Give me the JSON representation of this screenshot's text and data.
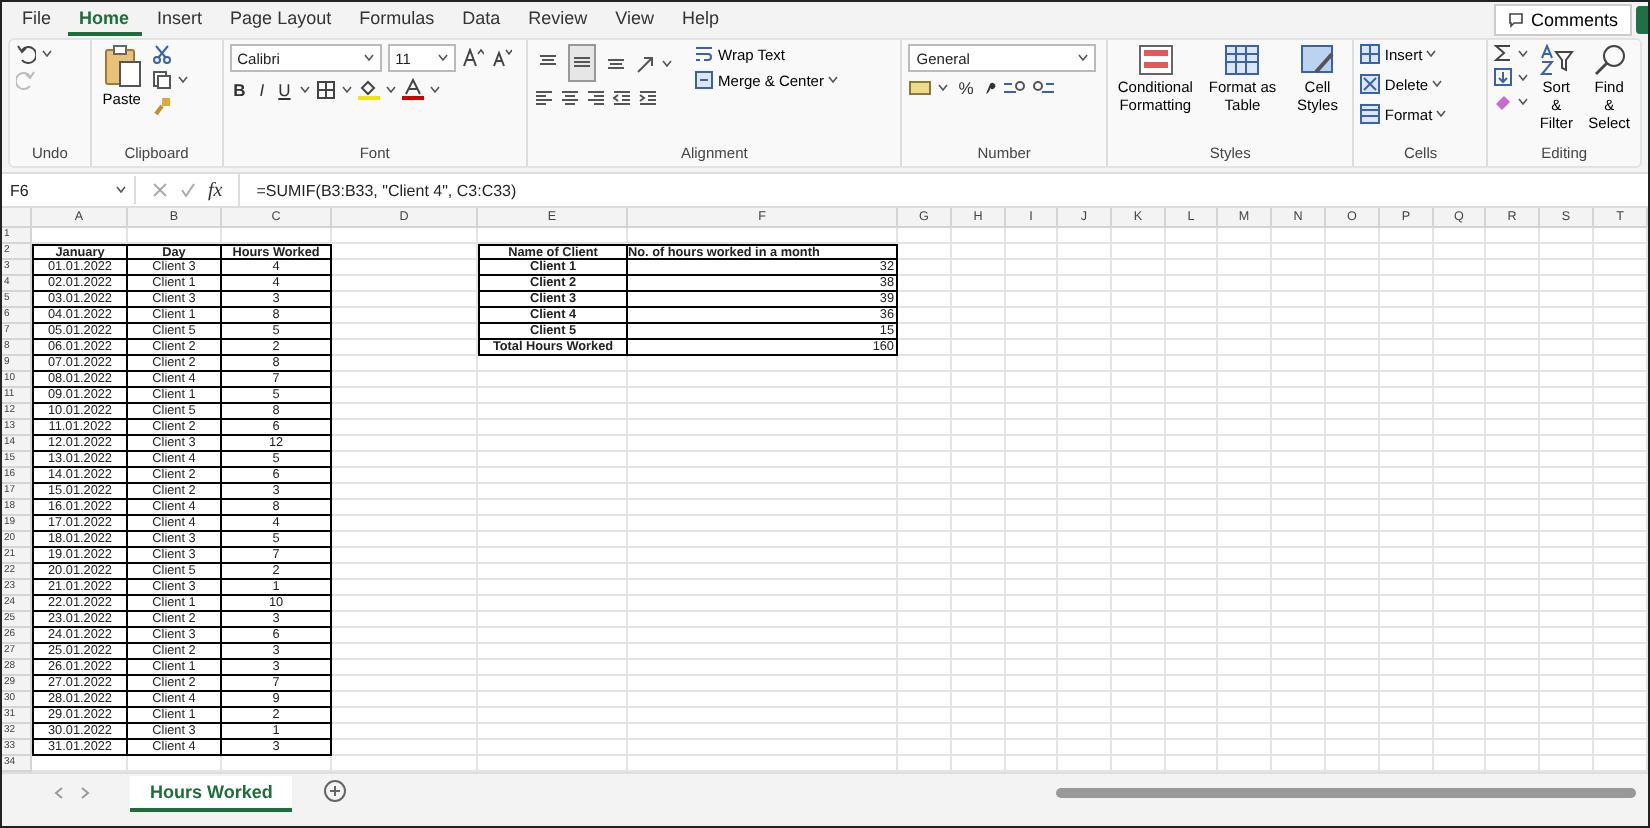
{
  "menu_tabs": [
    {
      "label": "File",
      "selected": false
    },
    {
      "label": "Home",
      "selected": true
    },
    {
      "label": "Insert",
      "selected": false
    },
    {
      "label": "Page Layout",
      "selected": false
    },
    {
      "label": "Formulas",
      "selected": false
    },
    {
      "label": "Data",
      "selected": false
    },
    {
      "label": "Review",
      "selected": false
    },
    {
      "label": "View",
      "selected": false
    },
    {
      "label": "Help",
      "selected": false
    }
  ],
  "comments_button": "Comments",
  "ribbon": {
    "undo": {
      "label": "Undo"
    },
    "clipboard": {
      "label": "Clipboard",
      "paste": "Paste"
    },
    "font": {
      "label": "Font",
      "font_name": "Calibri",
      "font_size": "11",
      "bold": "B",
      "italic": "I",
      "underline": "U"
    },
    "alignment": {
      "label": "Alignment",
      "vertical_align": [
        {
          "selected": false
        },
        {
          "selected": true
        },
        {
          "selected": false
        }
      ],
      "wrap_text": "Wrap Text",
      "merge_center": "Merge & Center"
    },
    "number": {
      "label": "Number",
      "format": "General",
      "percent": "%"
    },
    "styles": {
      "label": "Styles",
      "buttons": [
        "Conditional Formatting",
        "Format as Table",
        "Cell Styles"
      ]
    },
    "cells": {
      "label": "Cells",
      "buttons": [
        "Insert",
        "Delete",
        "Format"
      ]
    },
    "editing": {
      "label": "Editing",
      "buttons": [
        "Sort & Filter",
        "Find & Select"
      ]
    }
  },
  "formula_bar": {
    "name_box": "F6",
    "fx": "fx",
    "formula": "=SUMIF(B3:B33, \"Client 4\", C3:C33)"
  },
  "sheet": {
    "columns": [
      "A",
      "B",
      "C",
      "D",
      "E",
      "F",
      "G",
      "H",
      "I",
      "J",
      "K",
      "L",
      "M",
      "N",
      "O",
      "P",
      "Q",
      "R",
      "S",
      "T"
    ],
    "row_numbers": [
      "1",
      "2",
      "3",
      "4",
      "5",
      "6",
      "7",
      "8",
      "9",
      "10",
      "11",
      "12",
      "13",
      "14",
      "15",
      "16",
      "17",
      "18",
      "19",
      "20",
      "21",
      "22",
      "23",
      "24",
      "25",
      "26",
      "27",
      "28",
      "29",
      "30",
      "31",
      "32",
      "33",
      "34"
    ],
    "hours_table": {
      "columns": [
        "January",
        "Day",
        "Hours Worked"
      ],
      "rows": [
        [
          "01.01.2022",
          "Client 3",
          "4"
        ],
        [
          "02.01.2022",
          "Client 1",
          "4"
        ],
        [
          "03.01.2022",
          "Client 3",
          "3"
        ],
        [
          "04.01.2022",
          "Client 1",
          "8"
        ],
        [
          "05.01.2022",
          "Client 5",
          "5"
        ],
        [
          "06.01.2022",
          "Client 2",
          "2"
        ],
        [
          "07.01.2022",
          "Client 2",
          "8"
        ],
        [
          "08.01.2022",
          "Client 4",
          "7"
        ],
        [
          "09.01.2022",
          "Client 1",
          "5"
        ],
        [
          "10.01.2022",
          "Client 5",
          "8"
        ],
        [
          "11.01.2022",
          "Client 2",
          "6"
        ],
        [
          "12.01.2022",
          "Client 3",
          "12"
        ],
        [
          "13.01.2022",
          "Client 4",
          "5"
        ],
        [
          "14.01.2022",
          "Client 2",
          "6"
        ],
        [
          "15.01.2022",
          "Client 2",
          "3"
        ],
        [
          "16.01.2022",
          "Client 4",
          "8"
        ],
        [
          "17.01.2022",
          "Client 4",
          "4"
        ],
        [
          "18.01.2022",
          "Client 3",
          "5"
        ],
        [
          "19.01.2022",
          "Client 3",
          "7"
        ],
        [
          "20.01.2022",
          "Client 5",
          "2"
        ],
        [
          "21.01.2022",
          "Client 3",
          "1"
        ],
        [
          "22.01.2022",
          "Client 1",
          "10"
        ],
        [
          "23.01.2022",
          "Client 2",
          "3"
        ],
        [
          "24.01.2022",
          "Client 3",
          "6"
        ],
        [
          "25.01.2022",
          "Client 2",
          "3"
        ],
        [
          "26.01.2022",
          "Client 1",
          "3"
        ],
        [
          "27.01.2022",
          "Client 2",
          "7"
        ],
        [
          "28.01.2022",
          "Client 4",
          "9"
        ],
        [
          "29.01.2022",
          "Client 1",
          "2"
        ],
        [
          "30.01.2022",
          "Client 3",
          "1"
        ],
        [
          "31.01.2022",
          "Client 4",
          "3"
        ]
      ]
    },
    "summary_table": {
      "columns": [
        "Name of Client",
        "No. of hours worked in a month"
      ],
      "rows": [
        [
          "Client 1",
          "32"
        ],
        [
          "Client 2",
          "38"
        ],
        [
          "Client 3",
          "39"
        ],
        [
          "Client 4",
          "36"
        ],
        [
          "Client 5",
          "15"
        ],
        [
          "Total Hours Worked",
          "160"
        ]
      ]
    }
  },
  "sheet_tabs": [
    {
      "label": "Hours Worked",
      "selected": true
    }
  ]
}
